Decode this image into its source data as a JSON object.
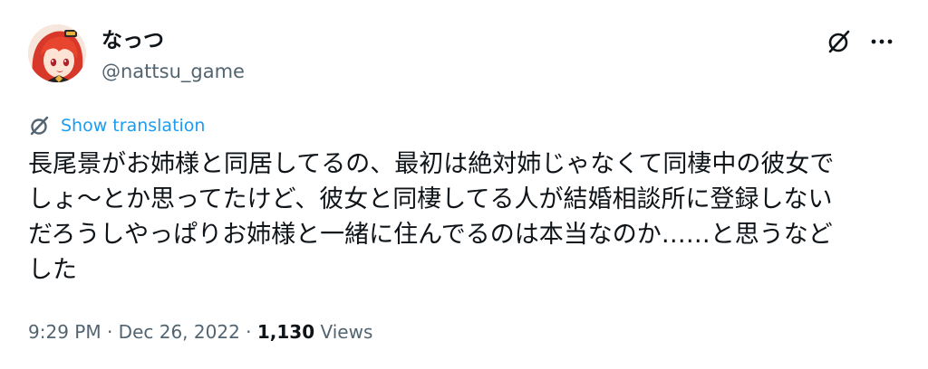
{
  "author": {
    "display_name": "なっつ",
    "handle": "@nattsu_game",
    "avatar": "anime-girl-red-hair-avatar"
  },
  "header": {
    "grok_icon": "slashed-circle-icon",
    "more_icon": "more-dots-icon"
  },
  "translation": {
    "icon": "globe-translate-icon",
    "label": "Show translation"
  },
  "tweet": {
    "lines": [
      "長尾景がお姉様と同居してるの、最初は絶対姉じゃなくて同棲中の彼女で",
      "しょ〜とか思ってたけど、彼女と同棲してる人が結婚相談所に登録しない",
      "だろうしやっぱりお姉様と一緒に住んでるのは本当なのか……と思うなど",
      "した"
    ]
  },
  "meta": {
    "time": "9:29 PM",
    "separator": "·",
    "date": "Dec 26, 2022",
    "views_count": "1,130",
    "views_label": "Views"
  },
  "colors": {
    "text": "#0f1419",
    "secondary": "#536471",
    "link": "#1d9bf0",
    "avatar_hair": "#e0402f"
  }
}
